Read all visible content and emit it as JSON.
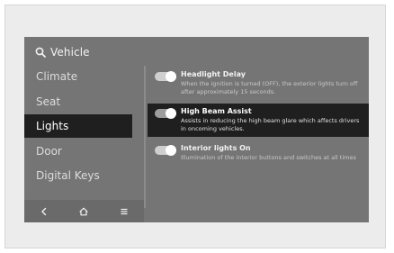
{
  "header": {
    "title": "Vehicle",
    "icon": "search-icon"
  },
  "menu": {
    "items": [
      {
        "label": "Climate"
      },
      {
        "label": "Seat"
      },
      {
        "label": "Lights"
      },
      {
        "label": "Door"
      },
      {
        "label": "Digital Keys"
      }
    ],
    "selected": "Lights"
  },
  "settings": [
    {
      "title": "Headlight Delay",
      "description": "When the ignition is turned (OFF), the exterior lights turn off after approximately 15 seconds.",
      "enabled": true
    },
    {
      "title": "High Beam Assist",
      "description": "Assists in reducing the high beam glare which affects drivers in oncoming vehicles.",
      "enabled": true
    },
    {
      "title": "Interior lights On",
      "description": "Illumination of the interior buttons and switches at all times",
      "enabled": true
    }
  ],
  "bottom_bar": {
    "icons": [
      "back-icon",
      "home-icon",
      "menu-icon"
    ]
  },
  "colors": {
    "screen_bg": "#757575",
    "selected_bg": "#1f1f1f",
    "text_primary": "#f2f2f2",
    "text_secondary": "#c9c9c9"
  }
}
